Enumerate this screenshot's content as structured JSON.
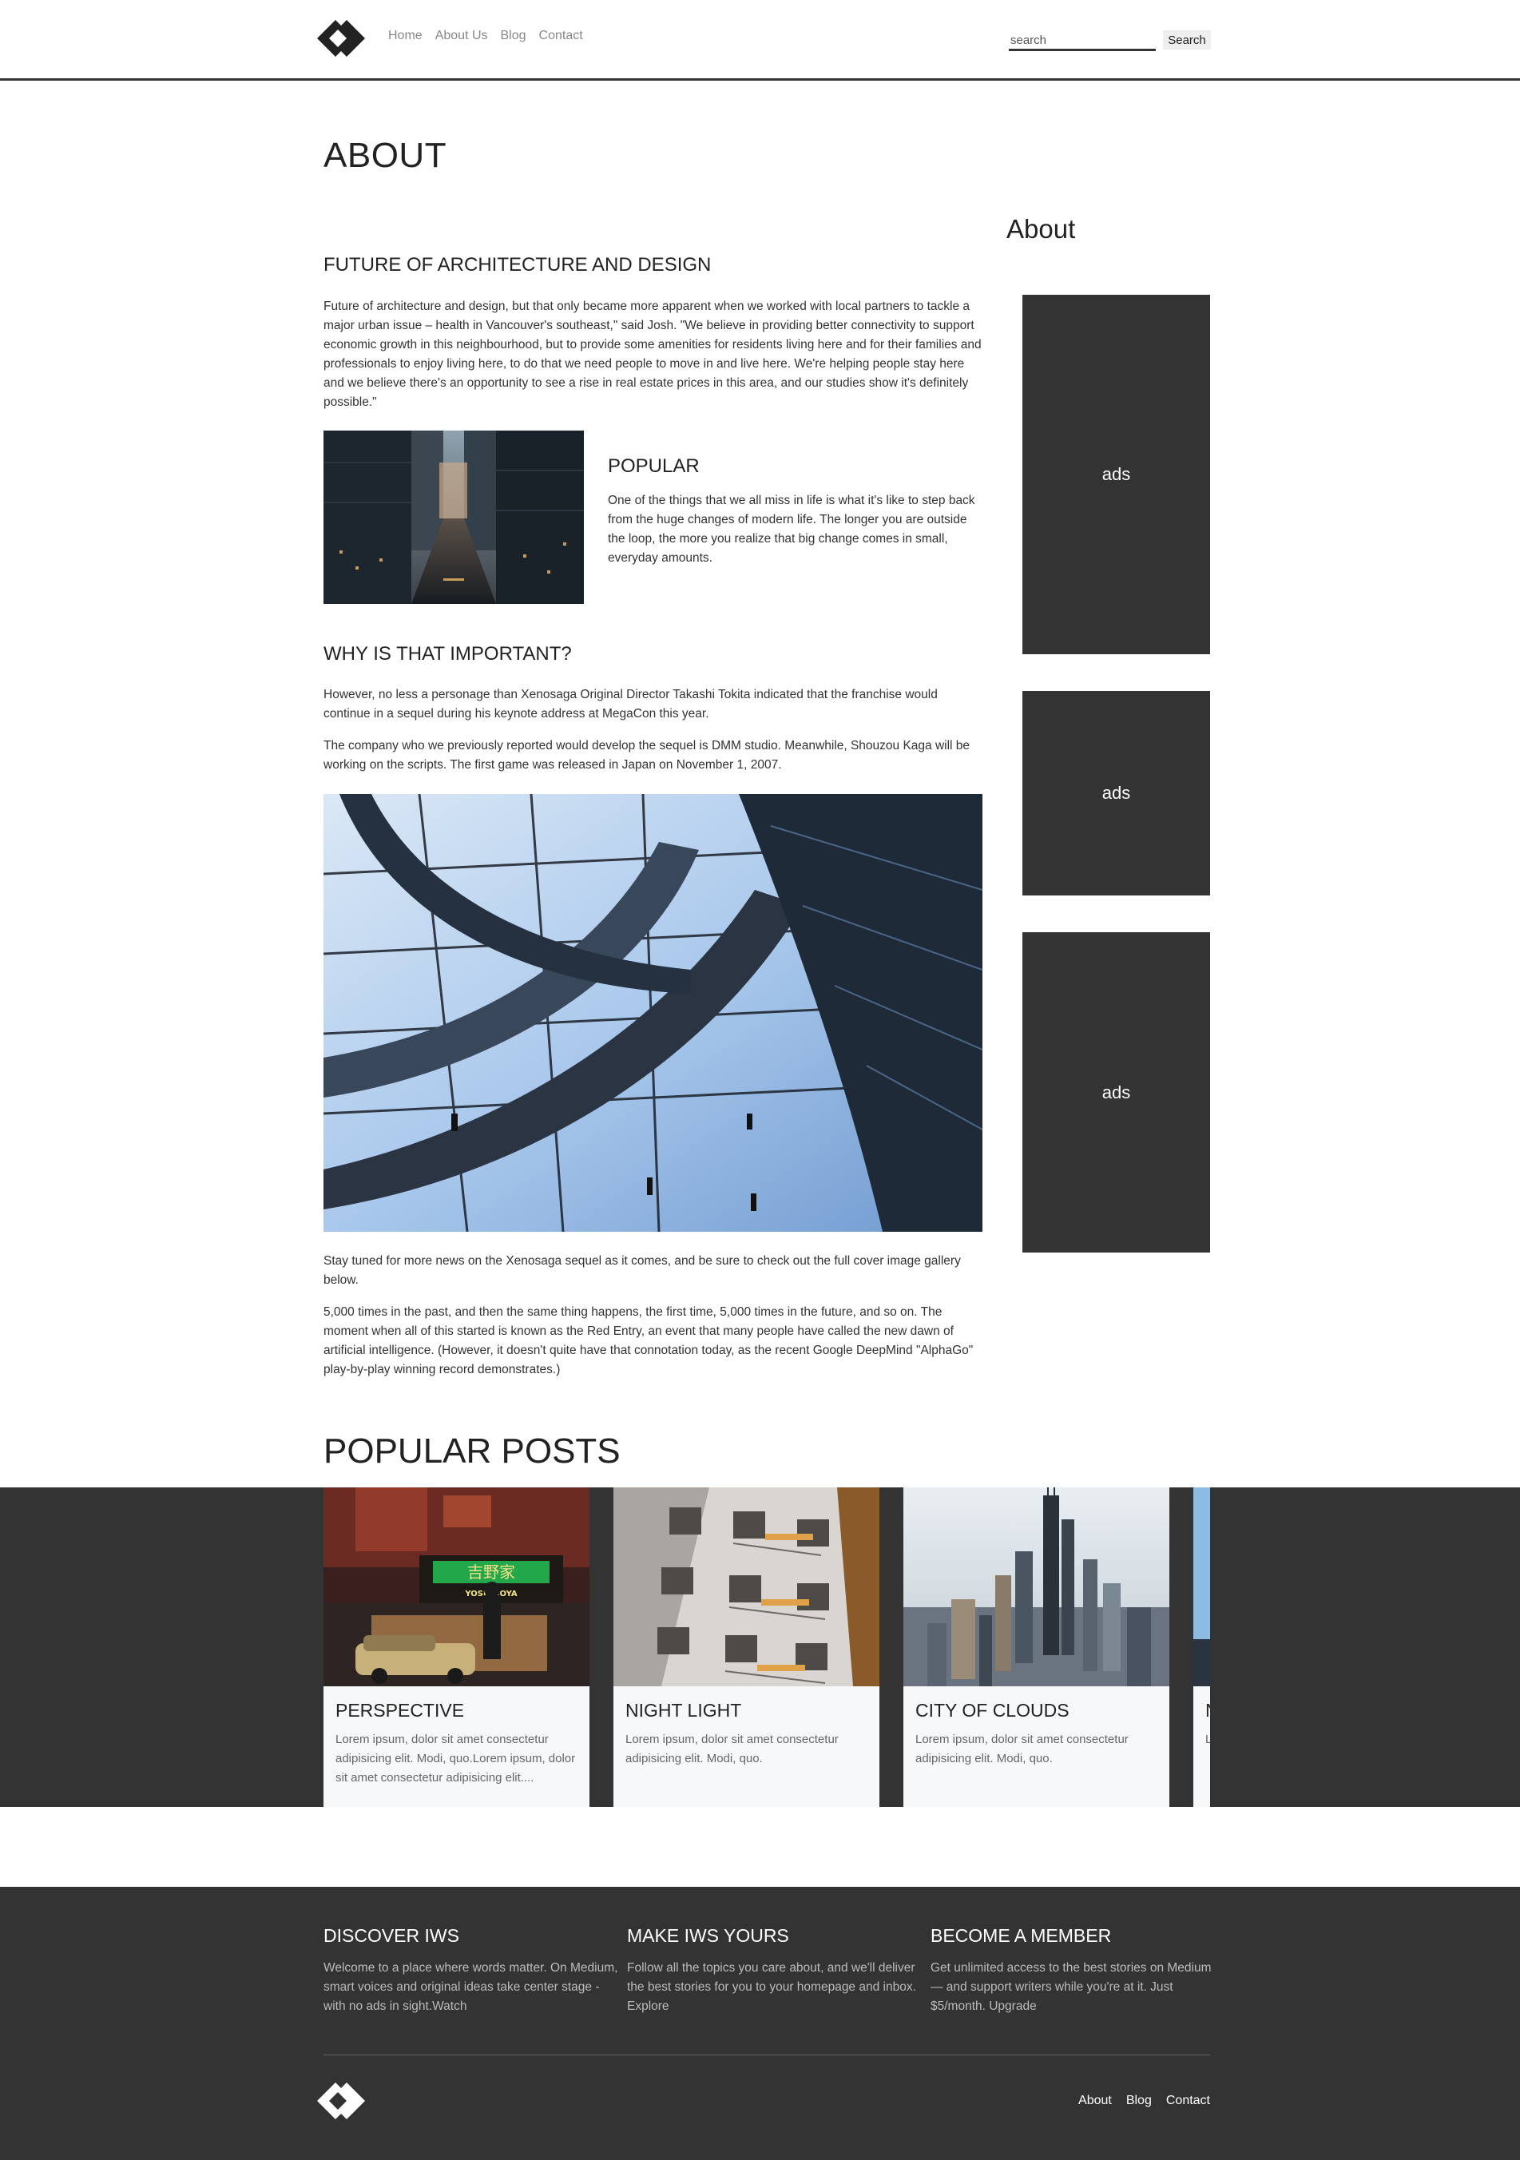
{
  "header": {
    "logo": "iws-logo",
    "nav": [
      "Home",
      "About Us",
      "Blog",
      "Contact"
    ],
    "search_placeholder": "search",
    "search_button": "Search"
  },
  "main": {
    "page_title": "ABOUT",
    "section1": {
      "heading": "FUTURE OF ARCHITECTURE AND DESIGN",
      "text": "Future of architecture and design, but that only became more apparent when we worked with local partners to tackle a major urban issue – health in Vancouver's southeast,\" said Josh. \"We believe in providing better connectivity to support economic growth in this neighbourhood, but to provide some amenities for residents living here and for their families and professionals to enjoy living here, to do that we need people to move in and live here. We're helping people stay here and we believe there's an opportunity to see a rise in real estate prices in this area, and our studies show it's definitely possible.\""
    },
    "popular": {
      "heading": "POPULAR",
      "text": "One of the things that we all miss in life is what it's like to step back from the huge changes of modern life. The longer you are outside the loop, the more you realize that big change comes in small, everyday amounts."
    },
    "section2": {
      "heading": "WHY IS THAT IMPORTANT?",
      "text1": "However, no less a personage than Xenosaga Original Director Takashi Tokita indicated that the franchise would continue in a sequel during his keynote address at MegaCon this year.",
      "text2": "The company who we previously reported would develop the sequel is DMM studio. Meanwhile, Shouzou Kaga will be working on the scripts. The first game was released in Japan on November 1, 2007.",
      "text3": "Stay tuned for more news on the Xenosaga sequel as it comes, and be sure to check out the full cover image gallery below.",
      "text4": "5,000 times in the past, and then the same thing happens, the first time, 5,000 times in the future, and so on. The moment when all of this started is known as the Red Entry, an event that many people have called the new dawn of artificial intelligence. (However, it doesn't quite have that connotation today, as the recent Google DeepMind \"AlphaGo\" play-by-play winning record demonstrates.)"
    }
  },
  "sidebar": {
    "title": "About",
    "ads": [
      "ads",
      "ads",
      "ads"
    ]
  },
  "popular_posts": {
    "title": "POPULAR POSTS",
    "cards": [
      {
        "title": "PERSPECTIVE",
        "text": "Lorem ipsum, dolor sit amet consectetur adipisicing elit. Modi, quo.Lorem ipsum, dolor sit amet consectetur adipisicing elit....",
        "sign": "吉野家",
        "sign_sub": "YOSHINOYA"
      },
      {
        "title": "NIGHT LIGHT",
        "text": "Lorem ipsum, dolor sit amet consectetur adipisicing elit. Modi, quo."
      },
      {
        "title": "CITY OF CLOUDS",
        "text": "Lorem ipsum, dolor sit amet consectetur adipisicing elit. Modi, quo."
      },
      {
        "title": "N",
        "text": "L a"
      }
    ]
  },
  "footer": {
    "columns": [
      {
        "title": "DISCOVER IWS",
        "text": "Welcome to a place where words matter. On Medium, smart voices and original ideas take center stage - with no ads in sight.Watch"
      },
      {
        "title": "MAKE IWS YOURS",
        "text": "Follow all the topics you care about, and we'll deliver the best stories for you to your homepage and inbox. Explore"
      },
      {
        "title": "BECOME A MEMBER",
        "text": "Get unlimited access to the best stories on Medium — and support writers while you're at it. Just $5/month. Upgrade"
      }
    ],
    "nav": [
      "About",
      "Blog",
      "Contact"
    ],
    "logo": "iws-logo"
  },
  "colors": {
    "dark": "#333333",
    "card_bg": "#f7f8fa",
    "muted_text": "#bbbbbb"
  }
}
